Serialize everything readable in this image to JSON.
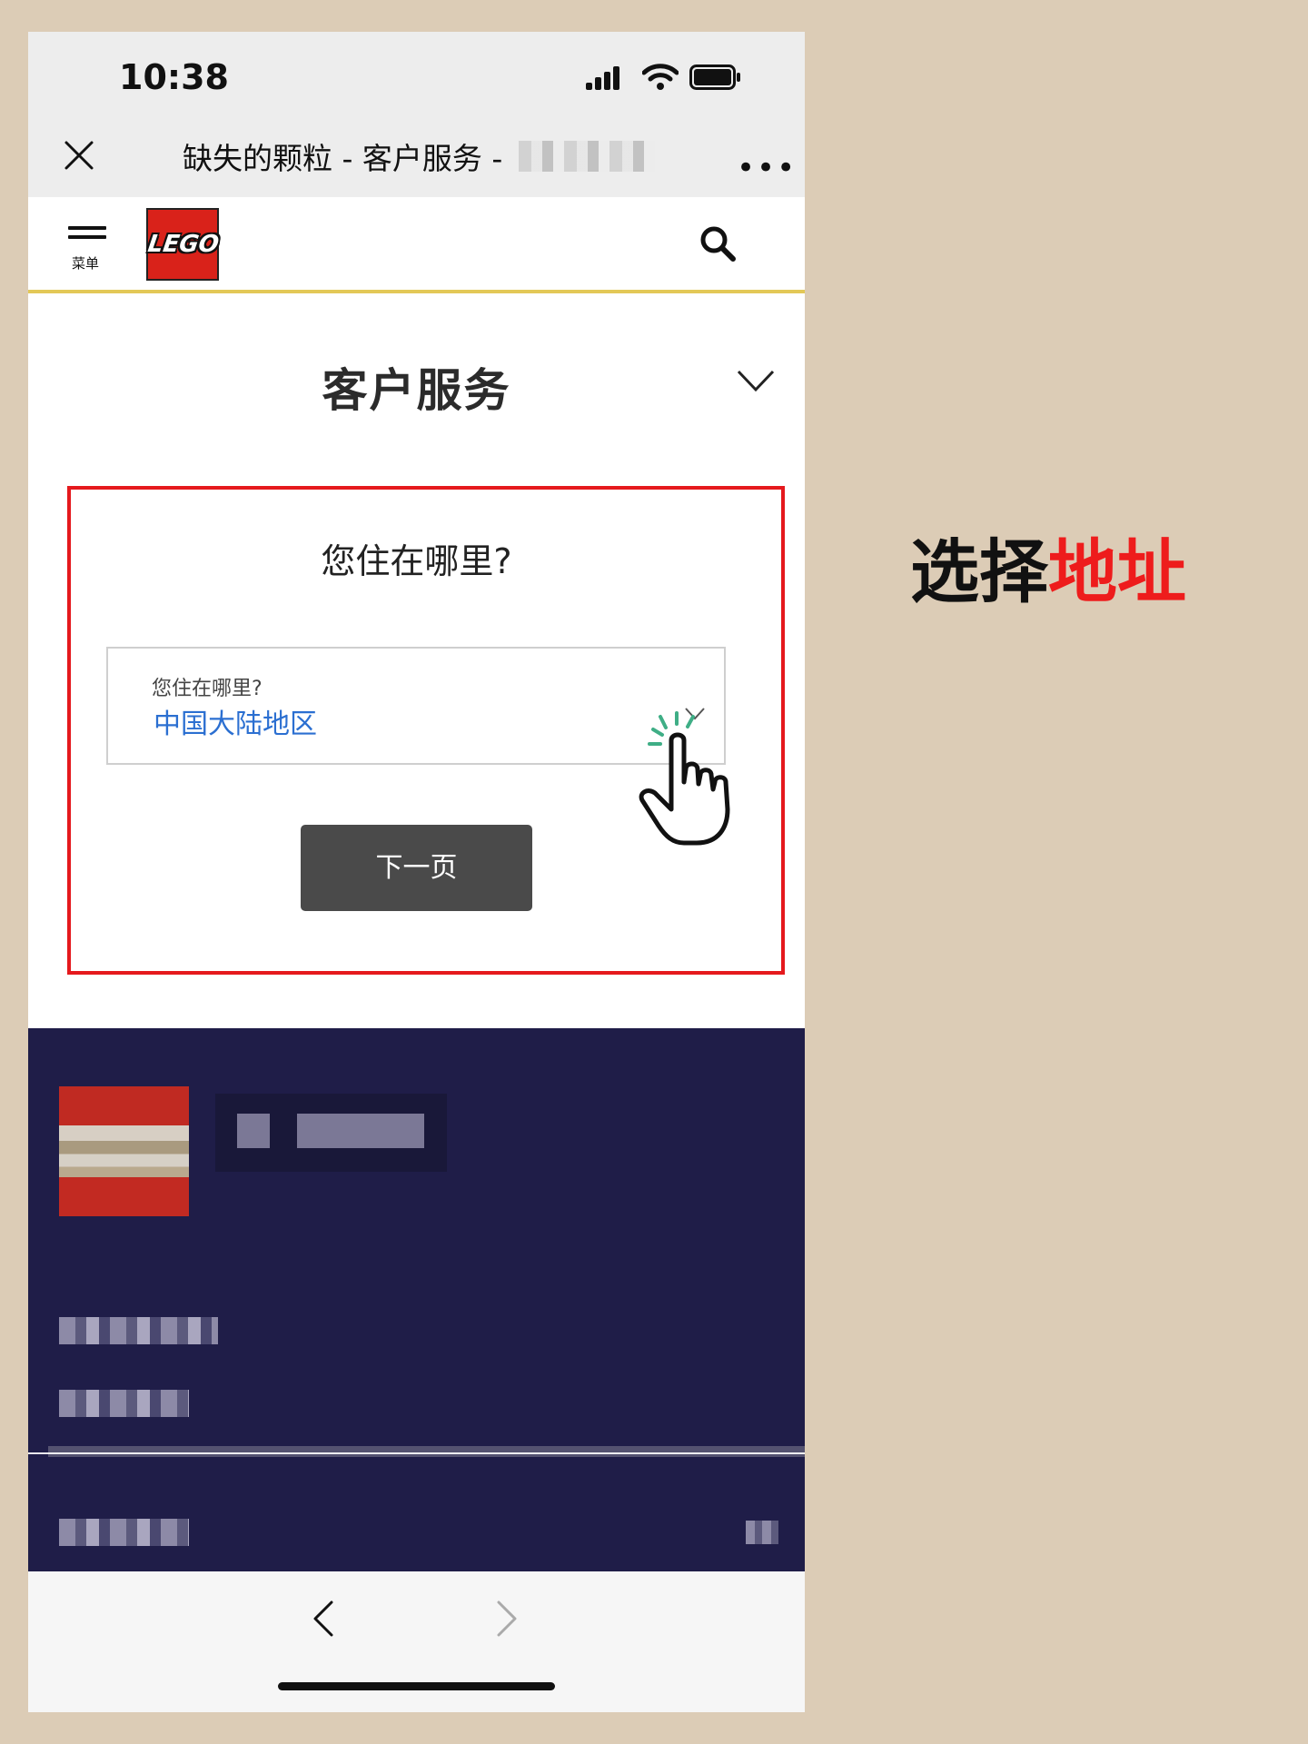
{
  "status_bar": {
    "time": "10:38"
  },
  "browser_header": {
    "title": "缺失的颗粒 - 客户服务 -"
  },
  "site_nav": {
    "menu_label": "菜单",
    "logo_text": "LEGO"
  },
  "page": {
    "title": "客户服务",
    "question": "您住在哪里?",
    "region_select": {
      "label": "您住在哪里?",
      "value": "中国大陆地区"
    },
    "next_button": "下一页"
  },
  "annotation": {
    "part1": "选择",
    "part2": "地址"
  },
  "colors": {
    "annotation_red": "#ee1c1c",
    "link_blue": "#2b6fd1",
    "footer_navy": "#1f1d48",
    "highlight_red": "#e5191d",
    "nav_gold": "#e3c857"
  }
}
